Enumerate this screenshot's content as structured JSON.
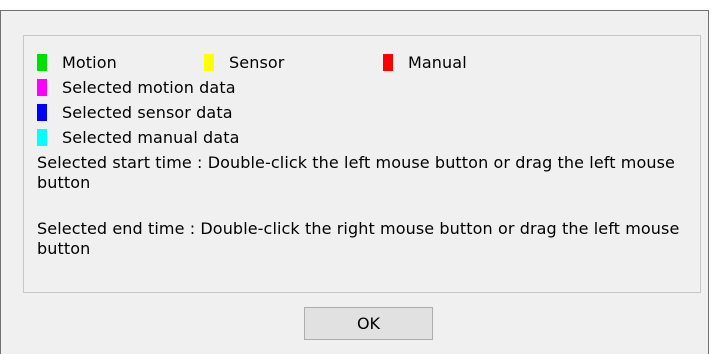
{
  "legend": {
    "motion": {
      "label": "Motion",
      "color": "#00e000"
    },
    "sensor": {
      "label": "Sensor",
      "color": "#ffff00"
    },
    "manual": {
      "label": "Manual",
      "color": "#ff0000"
    },
    "selected_motion": {
      "label": "Selected motion data",
      "color": "#ff00ff"
    },
    "selected_sensor": {
      "label": "Selected sensor data",
      "color": "#0000ff"
    },
    "selected_manual": {
      "label": "Selected manual data",
      "color": "#00ffff"
    }
  },
  "info": {
    "start_time": "Selected start time : Double-click the left mouse button or drag the left mouse button",
    "end_time": "Selected end time : Double-click the right mouse button or drag the left mouse button"
  },
  "buttons": {
    "ok_label": "OK"
  }
}
